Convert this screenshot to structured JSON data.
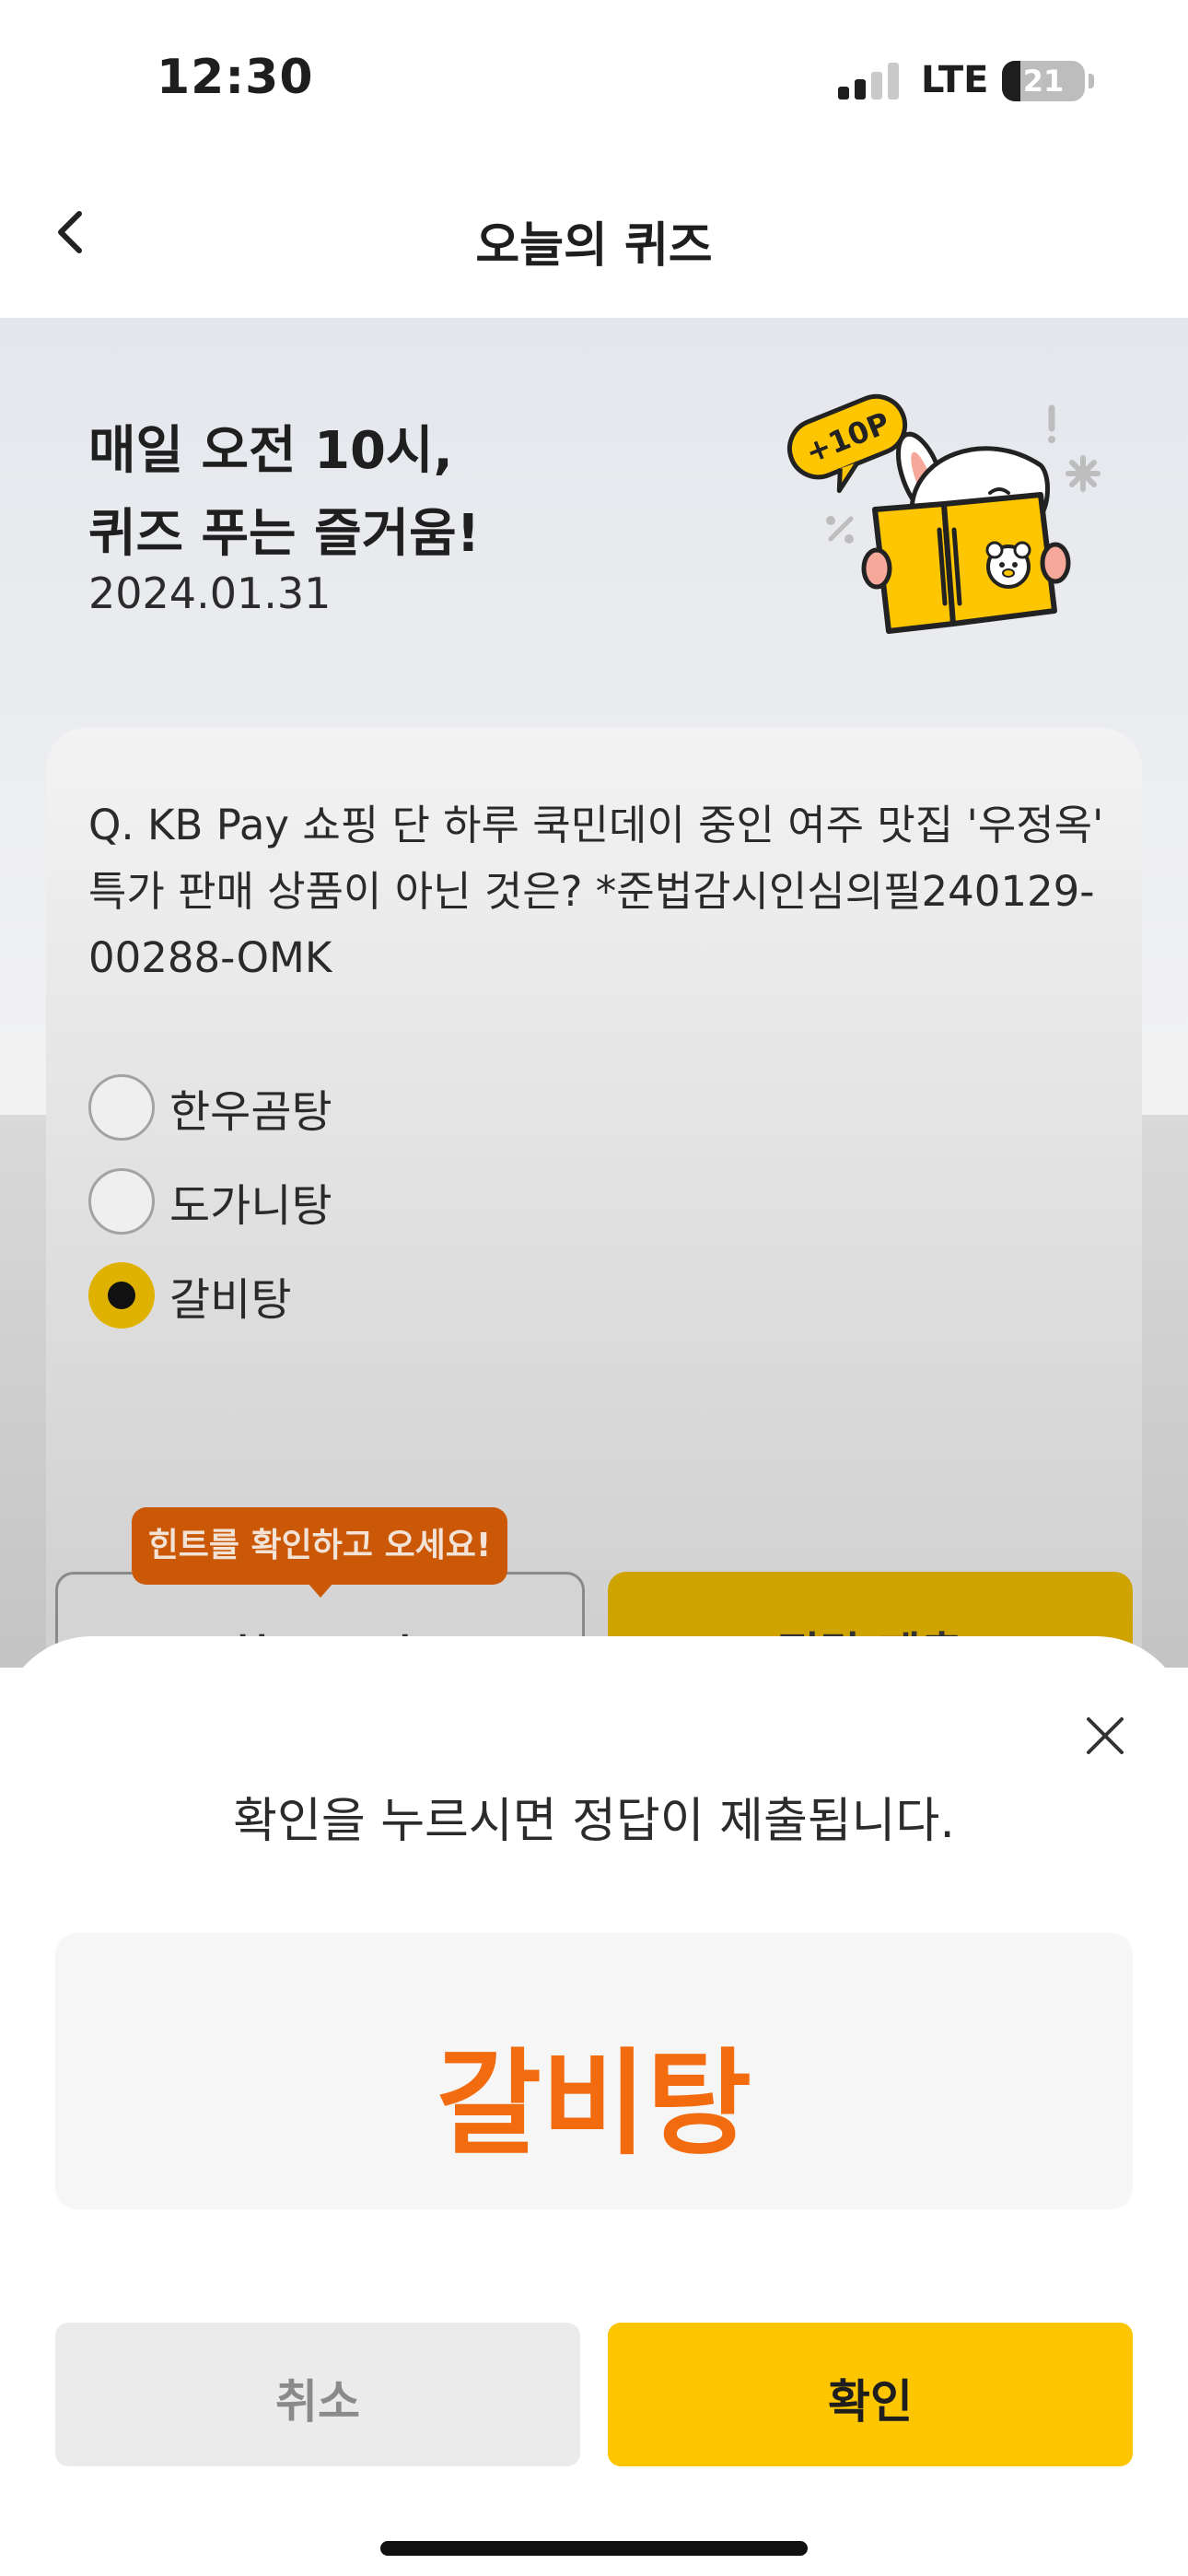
{
  "status_bar": {
    "time": "12:30",
    "network": "LTE",
    "battery_level": "21"
  },
  "nav": {
    "title": "오늘의 퀴즈"
  },
  "hero": {
    "title_line1": "매일 오전 10시,",
    "title_line2": "퀴즈 푸는 즐거움!",
    "date": "2024.01.31",
    "badge": "+10P"
  },
  "quiz": {
    "question_line1": "Q. KB Pay 쇼핑 단 하루 쿡민데이 중인 여주 맛집 '우정옥'",
    "question_line2": "특가 판매 상품이 아닌 것은? *준법감시인심의필240129-",
    "question_line3": "00288-OMK",
    "options": [
      {
        "label": "한우곰탕",
        "selected": false
      },
      {
        "label": "도가니탕",
        "selected": false
      },
      {
        "label": "갈비탕",
        "selected": true
      }
    ]
  },
  "actions": {
    "hint_label": "힌트 보기",
    "submit_label": "정답 제출",
    "hint_tooltip": "힌트를 확인하고 오세요!"
  },
  "sheet": {
    "message": "확인을 누르시면 정답이 제출됩니다.",
    "selected_answer": "갈비탕",
    "cancel_label": "취소",
    "confirm_label": "확인"
  },
  "colors": {
    "accent_yellow": "#fdc600",
    "answer_orange": "#f26b0f",
    "tooltip_orange": "#cb5806"
  }
}
